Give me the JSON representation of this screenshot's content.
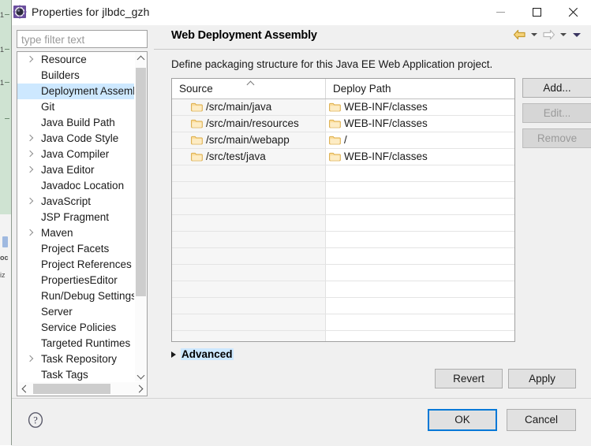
{
  "ide_backdrop": {
    "fragments": [
      "1",
      "1",
      "1",
      "oc",
      "iz"
    ]
  },
  "window": {
    "title": "Properties for jlbdc_gzh",
    "icon": "eclipse-properties-icon",
    "minimize_label": "Minimize",
    "maximize_label": "Maximize",
    "close_label": "Close"
  },
  "sidebar": {
    "filter": {
      "value": "",
      "placeholder": "type filter text"
    },
    "items": [
      {
        "label": "Resource",
        "expandable": true,
        "selected": false
      },
      {
        "label": "Builders",
        "expandable": false,
        "selected": false
      },
      {
        "label": "Deployment Assembly",
        "expandable": false,
        "selected": true
      },
      {
        "label": "Git",
        "expandable": false,
        "selected": false
      },
      {
        "label": "Java Build Path",
        "expandable": false,
        "selected": false
      },
      {
        "label": "Java Code Style",
        "expandable": true,
        "selected": false
      },
      {
        "label": "Java Compiler",
        "expandable": true,
        "selected": false
      },
      {
        "label": "Java Editor",
        "expandable": true,
        "selected": false
      },
      {
        "label": "Javadoc Location",
        "expandable": false,
        "selected": false
      },
      {
        "label": "JavaScript",
        "expandable": true,
        "selected": false
      },
      {
        "label": "JSP Fragment",
        "expandable": false,
        "selected": false
      },
      {
        "label": "Maven",
        "expandable": true,
        "selected": false
      },
      {
        "label": "Project Facets",
        "expandable": false,
        "selected": false
      },
      {
        "label": "Project References",
        "expandable": false,
        "selected": false
      },
      {
        "label": "PropertiesEditor",
        "expandable": false,
        "selected": false
      },
      {
        "label": "Run/Debug Settings",
        "expandable": false,
        "selected": false
      },
      {
        "label": "Server",
        "expandable": false,
        "selected": false
      },
      {
        "label": "Service Policies",
        "expandable": false,
        "selected": false
      },
      {
        "label": "Targeted Runtimes",
        "expandable": false,
        "selected": false
      },
      {
        "label": "Task Repository",
        "expandable": true,
        "selected": false
      },
      {
        "label": "Task Tags",
        "expandable": false,
        "selected": false
      }
    ]
  },
  "page": {
    "title": "Web Deployment Assembly",
    "description": "Define packaging structure for this Java EE Web Application project.",
    "nav": {
      "back_icon": "back-arrow-icon",
      "back_menu_icon": "chevron-down-icon",
      "forward_icon": "forward-arrow-icon",
      "forward_menu_icon": "chevron-down-icon",
      "overflow_icon": "chevron-down-icon"
    }
  },
  "table": {
    "columns": [
      {
        "label": "Source",
        "sorted": true,
        "sort_icon": "sort-ascending-icon"
      },
      {
        "label": "Deploy Path",
        "sorted": false
      }
    ],
    "rows": [
      {
        "source": "/src/main/java",
        "deploy": "WEB-INF/classes"
      },
      {
        "source": "/src/main/resources",
        "deploy": "WEB-INF/classes"
      },
      {
        "source": "/src/main/webapp",
        "deploy": "/"
      },
      {
        "source": "/src/test/java",
        "deploy": "WEB-INF/classes"
      }
    ],
    "empty_row_count": 12,
    "folder_icon": "folder-icon"
  },
  "side_buttons": [
    {
      "label": "Add...",
      "enabled": true
    },
    {
      "label": "Edit...",
      "enabled": false
    },
    {
      "label": "Remove",
      "enabled": false
    }
  ],
  "advanced": {
    "label": "Advanced",
    "expanded": false,
    "toggle_icon": "triangle-right-icon"
  },
  "page_buttons": {
    "revert": "Revert",
    "apply": "Apply"
  },
  "footer": {
    "help_icon": "help-question-icon",
    "ok": "OK",
    "cancel": "Cancel"
  },
  "colors": {
    "selection": "#cde8ff",
    "focus_border": "#0078d7",
    "dialog_bg": "#f0f0f0",
    "folder": "#f5c86e",
    "ide_green": "#cfe3d2"
  }
}
